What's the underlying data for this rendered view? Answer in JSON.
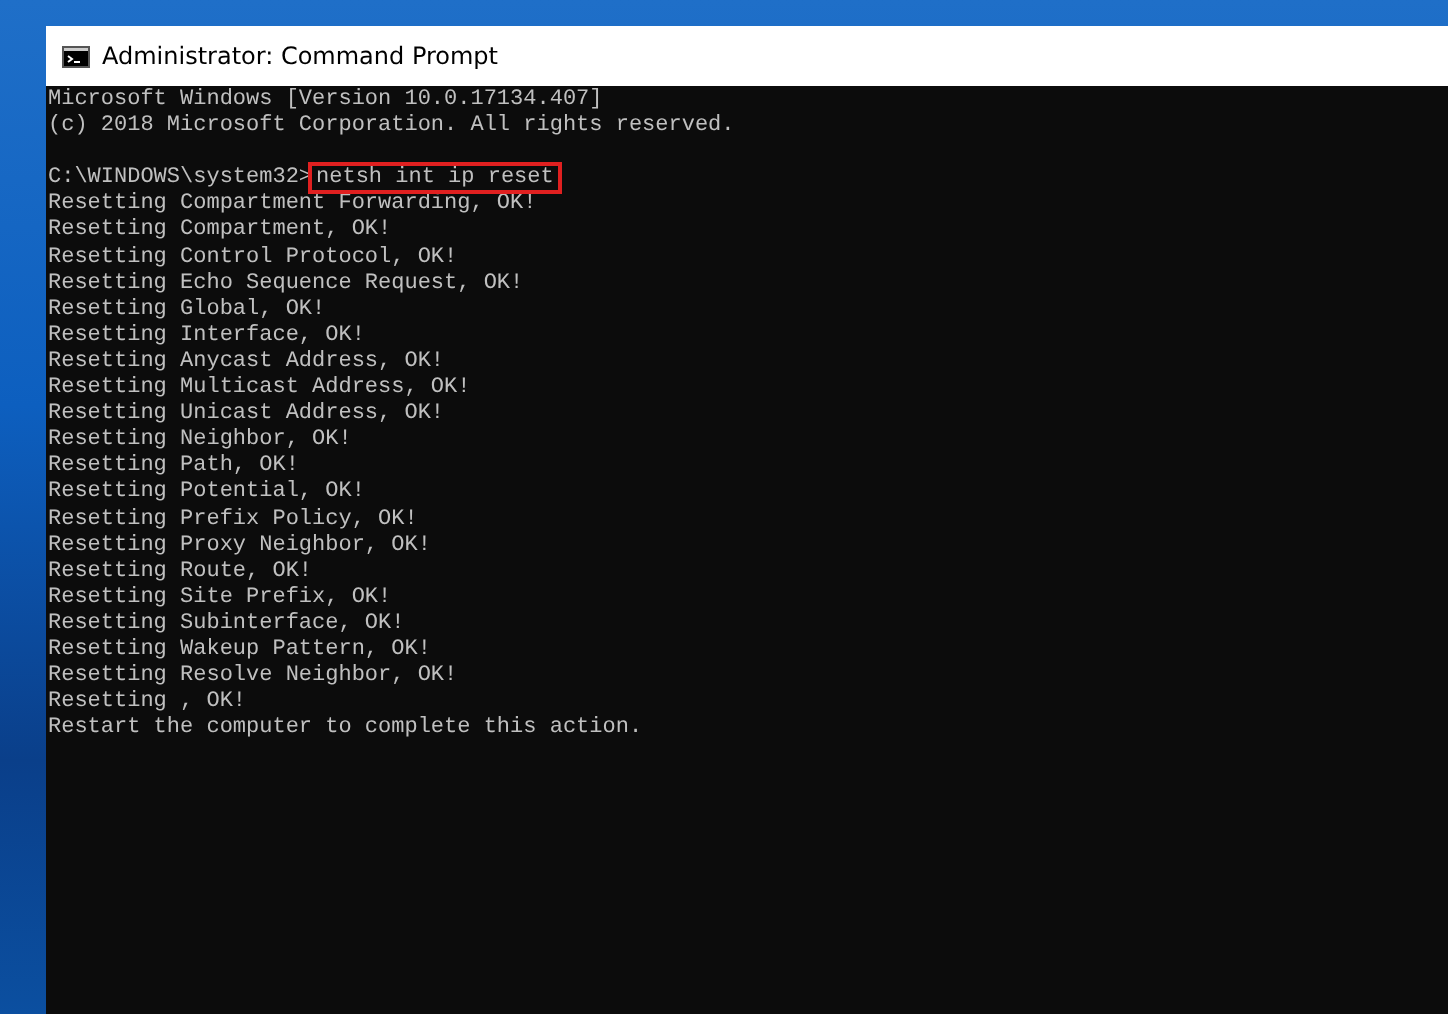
{
  "window": {
    "title": "Administrator: Command Prompt"
  },
  "console": {
    "lines": [
      {
        "kind": "output",
        "text": "Microsoft Windows [Version 10.0.17134.407]"
      },
      {
        "kind": "output",
        "text": "(c) 2018 Microsoft Corporation. All rights reserved."
      },
      {
        "kind": "blank"
      },
      {
        "kind": "prompt",
        "prompt": "C:\\WINDOWS\\system32>",
        "command": "netsh int ip reset",
        "highlighted": true
      },
      {
        "kind": "output",
        "text": "Resetting Compartment Forwarding, OK!"
      },
      {
        "kind": "output",
        "text": "Resetting Compartment, OK!"
      },
      {
        "kind": "output",
        "text": "Resetting Control Protocol, OK!"
      },
      {
        "kind": "output",
        "text": "Resetting Echo Sequence Request, OK!"
      },
      {
        "kind": "output",
        "text": "Resetting Global, OK!"
      },
      {
        "kind": "output",
        "text": "Resetting Interface, OK!"
      },
      {
        "kind": "output",
        "text": "Resetting Anycast Address, OK!"
      },
      {
        "kind": "output",
        "text": "Resetting Multicast Address, OK!"
      },
      {
        "kind": "output",
        "text": "Resetting Unicast Address, OK!"
      },
      {
        "kind": "output",
        "text": "Resetting Neighbor, OK!"
      },
      {
        "kind": "output",
        "text": "Resetting Path, OK!"
      },
      {
        "kind": "output",
        "text": "Resetting Potential, OK!"
      },
      {
        "kind": "output",
        "text": "Resetting Prefix Policy, OK!"
      },
      {
        "kind": "output",
        "text": "Resetting Proxy Neighbor, OK!"
      },
      {
        "kind": "output",
        "text": "Resetting Route, OK!"
      },
      {
        "kind": "output",
        "text": "Resetting Site Prefix, OK!"
      },
      {
        "kind": "output",
        "text": "Resetting Subinterface, OK!"
      },
      {
        "kind": "output",
        "text": "Resetting Wakeup Pattern, OK!"
      },
      {
        "kind": "output",
        "text": "Resetting Resolve Neighbor, OK!"
      },
      {
        "kind": "output",
        "text": "Resetting , OK!"
      },
      {
        "kind": "output",
        "text": "Restart the computer to complete this action."
      }
    ]
  }
}
